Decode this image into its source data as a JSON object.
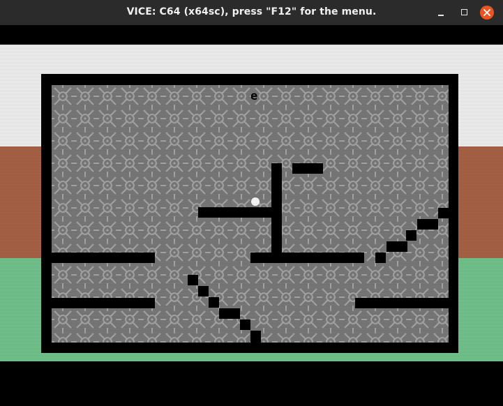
{
  "window": {
    "title": "VICE: C64 (x64sc), press \"F12\" for the menu.",
    "controls": {
      "minimize_icon": "minimize-icon",
      "maximize_icon": "maximize-icon",
      "close_icon": "close-icon"
    }
  },
  "screen": {
    "background_stripes": [
      {
        "name": "white",
        "color": "#f4f4f4"
      },
      {
        "name": "brown",
        "color": "#a86449"
      },
      {
        "name": "green",
        "color": "#76c490"
      }
    ],
    "playfield": {
      "border_color": "#000000",
      "pattern_bg": "#7a7a7a",
      "pattern_fg": "#a8a8a8",
      "score_glyph": "e",
      "ball_color": "#ffffff"
    }
  }
}
